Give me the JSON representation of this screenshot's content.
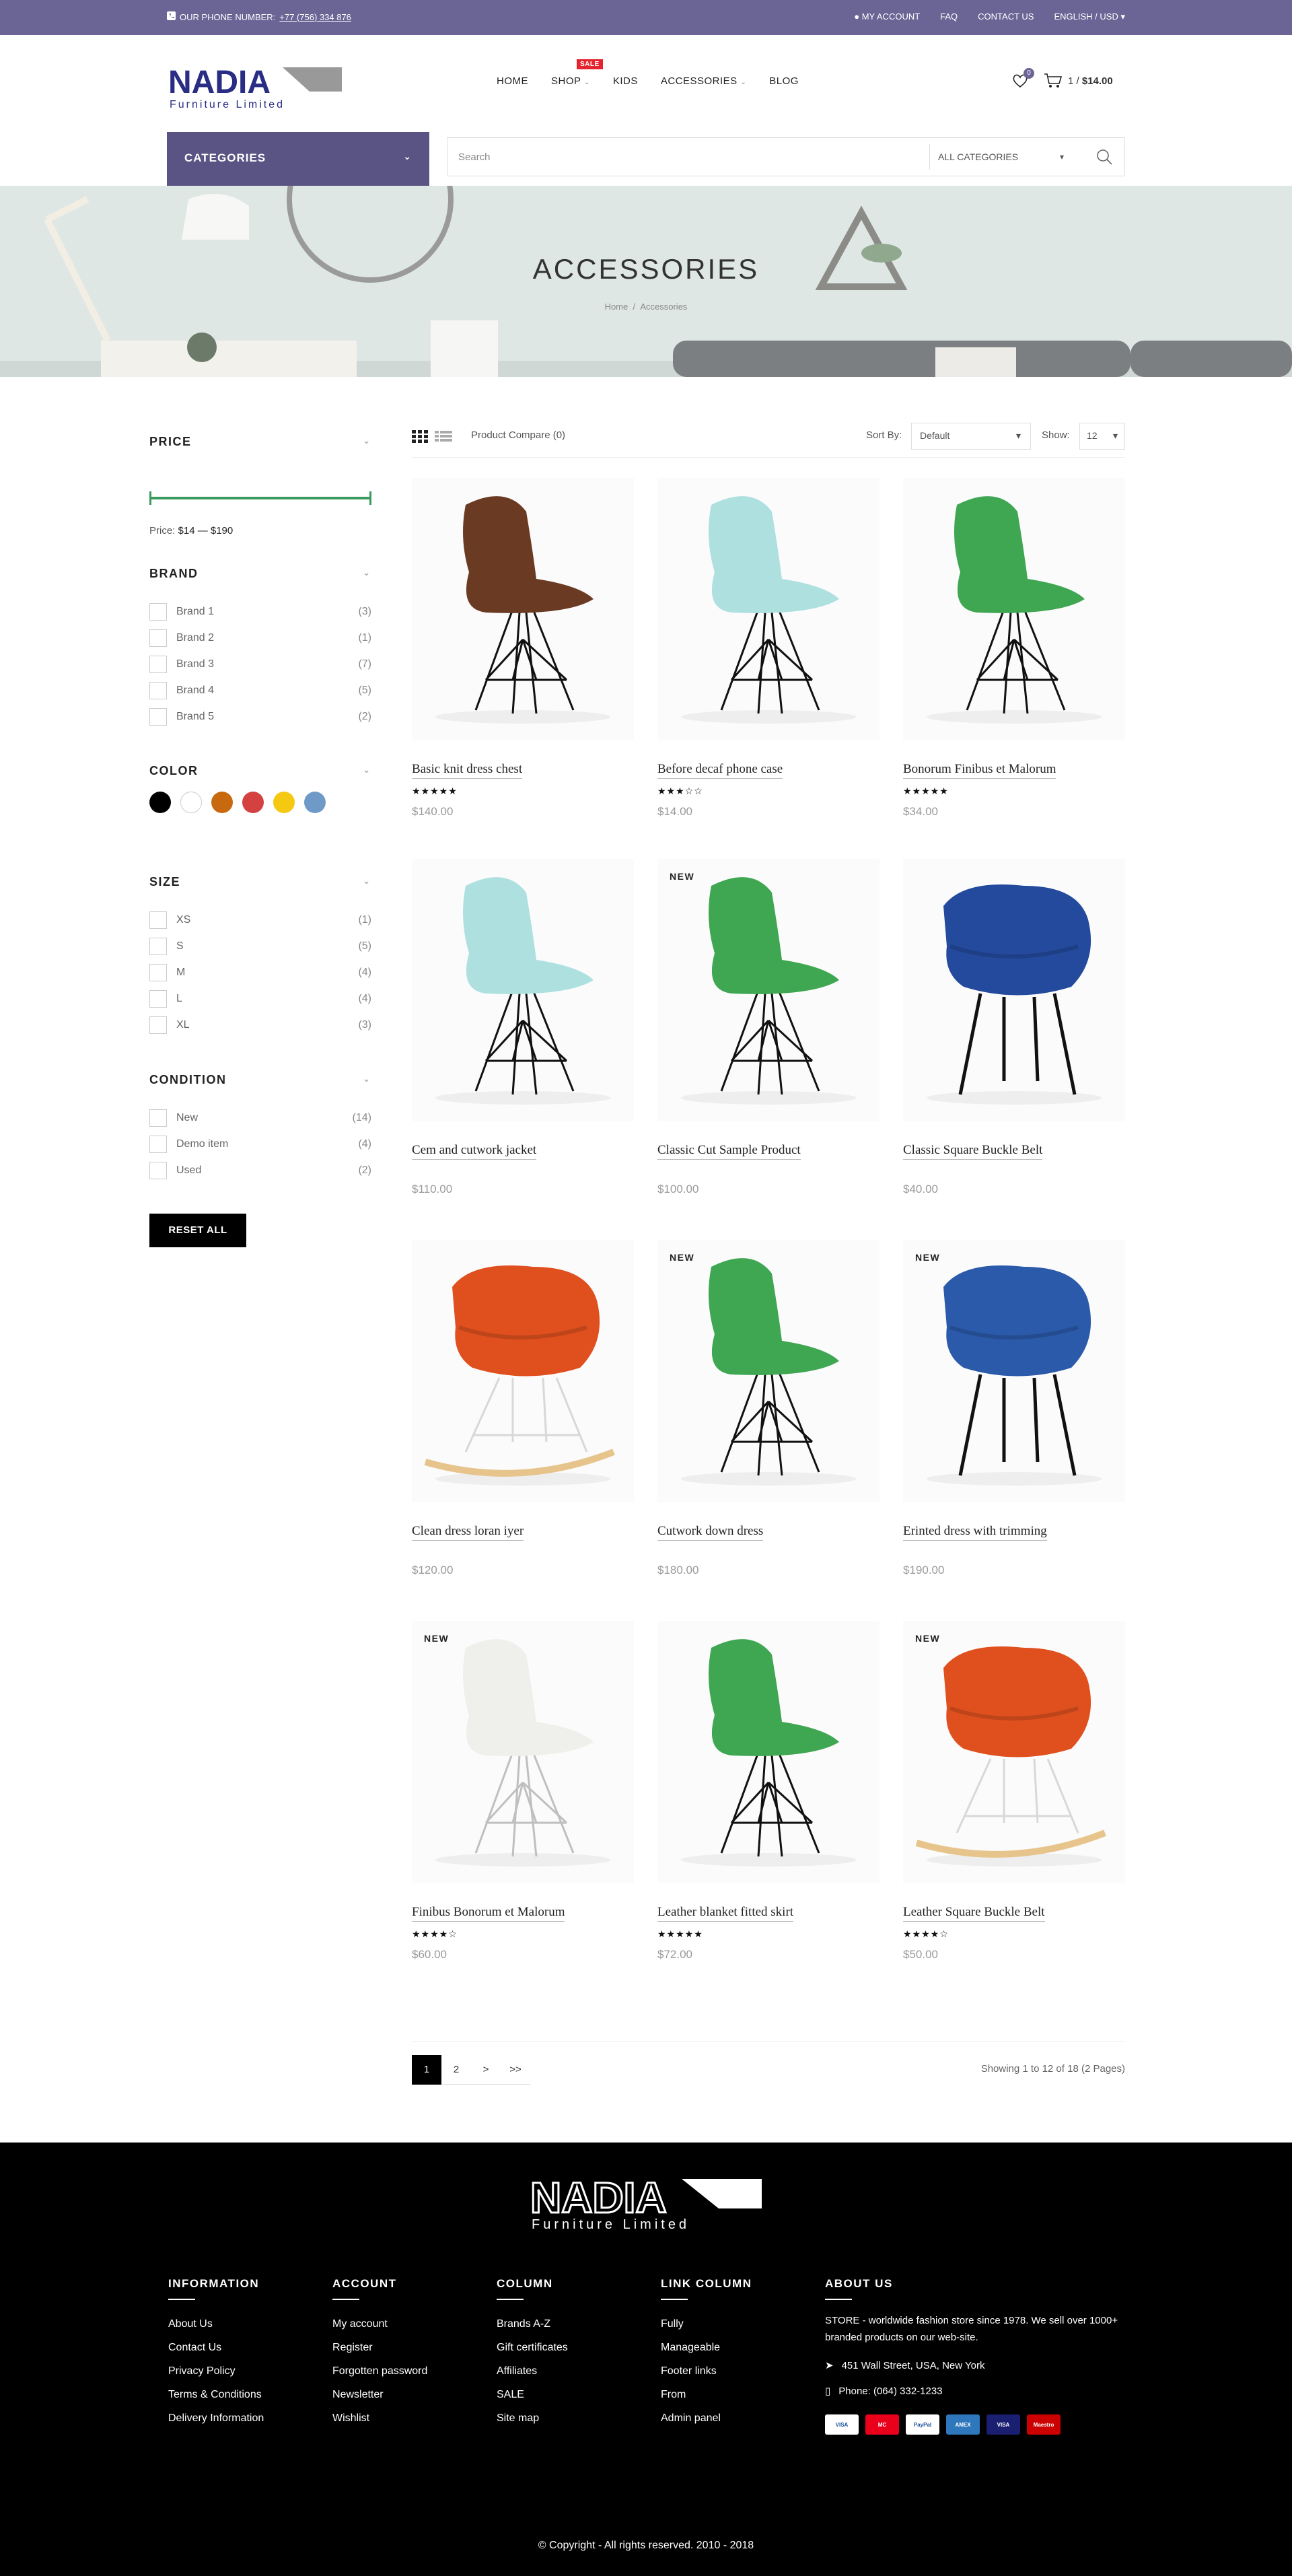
{
  "topbar": {
    "phone_label": "OUR PHONE NUMBER:",
    "phone": "+77 (756) 334 876",
    "links": [
      "MY ACCOUNT",
      "FAQ",
      "CONTACT US",
      "ENGLISH / USD"
    ]
  },
  "logo": {
    "name": "NADIA",
    "tagline": "Furniture Limited"
  },
  "nav": {
    "items": [
      "HOME",
      "SHOP",
      "KIDS",
      "ACCESSORIES",
      "BLOG"
    ],
    "sale_badge": "SALE"
  },
  "header": {
    "wishlist_count": "0",
    "cart_text": "1 / ",
    "cart_total": "$14.00"
  },
  "categories_label": "CATEGORIES",
  "search": {
    "placeholder": "Search",
    "category": "ALL CATEGORIES"
  },
  "banner": {
    "title": "ACCESSORIES",
    "crumb_home": "Home",
    "crumb_sep": "/",
    "crumb_current": "Accessories"
  },
  "filters": {
    "price": {
      "title": "PRICE",
      "label": "Price:",
      "range": "$14 — $190"
    },
    "brand": {
      "title": "BRAND",
      "items": [
        {
          "label": "Brand 1",
          "count": "(3)"
        },
        {
          "label": "Brand 2",
          "count": "(1)"
        },
        {
          "label": "Brand 3",
          "count": "(7)"
        },
        {
          "label": "Brand 4",
          "count": "(5)"
        },
        {
          "label": "Brand 5",
          "count": "(2)"
        }
      ]
    },
    "color": {
      "title": "COLOR",
      "swatches": [
        "#000000",
        "#ffffff",
        "#c8690f",
        "#d34141",
        "#f5c812",
        "#6f9ac7"
      ]
    },
    "size": {
      "title": "SIZE",
      "items": [
        {
          "label": "XS",
          "count": "(1)"
        },
        {
          "label": "S",
          "count": "(5)"
        },
        {
          "label": "M",
          "count": "(4)"
        },
        {
          "label": "L",
          "count": "(4)"
        },
        {
          "label": "XL",
          "count": "(3)"
        }
      ]
    },
    "condition": {
      "title": "CONDITION",
      "items": [
        {
          "label": "New",
          "count": "(14)"
        },
        {
          "label": "Demo item",
          "count": "(4)"
        },
        {
          "label": "Used",
          "count": "(2)"
        }
      ]
    },
    "reset": "RESET ALL"
  },
  "toolbar": {
    "compare": "Product Compare (0)",
    "sort_label": "Sort By:",
    "sort_value": "Default",
    "show_label": "Show:",
    "show_value": "12"
  },
  "products": [
    {
      "name": "Basic knit dress chest",
      "price": "$140.00",
      "stars": "★★★★★",
      "badge": "",
      "color": "#6b3a22",
      "base": "wire"
    },
    {
      "name": "Before decaf phone case",
      "price": "$14.00",
      "stars": "★★★☆☆",
      "badge": "",
      "color": "#aee0e0",
      "base": "wire"
    },
    {
      "name": "Bonorum Finibus et Malorum",
      "price": "$34.00",
      "stars": "★★★★★",
      "badge": "",
      "color": "#3fa652",
      "base": "wire"
    },
    {
      "name": "Cem and cutwork jacket",
      "price": "$110.00",
      "stars": "",
      "badge": "",
      "color": "#aee0e0",
      "base": "wire"
    },
    {
      "name": "Classic Cut Sample Product",
      "price": "$100.00",
      "stars": "",
      "badge": "NEW",
      "color": "#3fa652",
      "base": "wire"
    },
    {
      "name": "Classic Square Buckle Belt",
      "price": "$40.00",
      "stars": "",
      "badge": "",
      "color": "#244a9e",
      "base": "legs"
    },
    {
      "name": "Clean dress loran iyer",
      "price": "$120.00",
      "stars": "",
      "badge": "",
      "color": "#e0501f",
      "base": "rocker"
    },
    {
      "name": "Cutwork down dress",
      "price": "$180.00",
      "stars": "",
      "badge": "NEW",
      "color": "#3fa652",
      "base": "wire"
    },
    {
      "name": "Erinted dress with trimming",
      "price": "$190.00",
      "stars": "",
      "badge": "NEW",
      "color": "#2b5aaa",
      "base": "legs"
    },
    {
      "name": "Finibus Bonorum et Malorum",
      "price": "$60.00",
      "stars": "★★★★☆",
      "badge": "NEW",
      "color": "#efefec",
      "base": "white"
    },
    {
      "name": "Leather blanket fitted skirt",
      "price": "$72.00",
      "stars": "★★★★★",
      "badge": "",
      "color": "#3fa652",
      "base": "wire"
    },
    {
      "name": "Leather Square Buckle Belt",
      "price": "$50.00",
      "stars": "★★★★☆",
      "badge": "NEW",
      "color": "#e0501f",
      "base": "rocker"
    }
  ],
  "pagination": {
    "pages": [
      "1",
      "2",
      ">",
      ">>"
    ],
    "info": "Showing 1 to 12 of 18 (2 Pages)"
  },
  "footer": {
    "cols": [
      {
        "title": "INFORMATION",
        "items": [
          "About Us",
          "Contact Us",
          "Privacy Policy",
          "Terms & Conditions",
          "Delivery Information"
        ]
      },
      {
        "title": "ACCOUNT",
        "items": [
          "My account",
          "Register",
          "Forgotten password",
          "Newsletter",
          "Wishlist"
        ]
      },
      {
        "title": "COLUMN",
        "items": [
          "Brands A-Z",
          "Gift certificates",
          "Affiliates",
          "SALE",
          "Site map"
        ]
      },
      {
        "title": "LINK COLUMN",
        "items": [
          "Fully",
          "Manageable",
          "Footer links",
          "From",
          "Admin panel"
        ]
      }
    ],
    "about": {
      "title": "ABOUT US",
      "text": "STORE - worldwide fashion store since 1978. We sell over 1000+ branded products on our web-site.",
      "address": "451 Wall Street, USA, New York",
      "phone": "Phone: (064) 332-1233",
      "cards": [
        "VISA",
        "MC",
        "PayPal",
        "AMEX",
        "VISA",
        "Maestro"
      ]
    },
    "copyright": "© Copyright - All rights reserved. 2010 - 2018"
  }
}
